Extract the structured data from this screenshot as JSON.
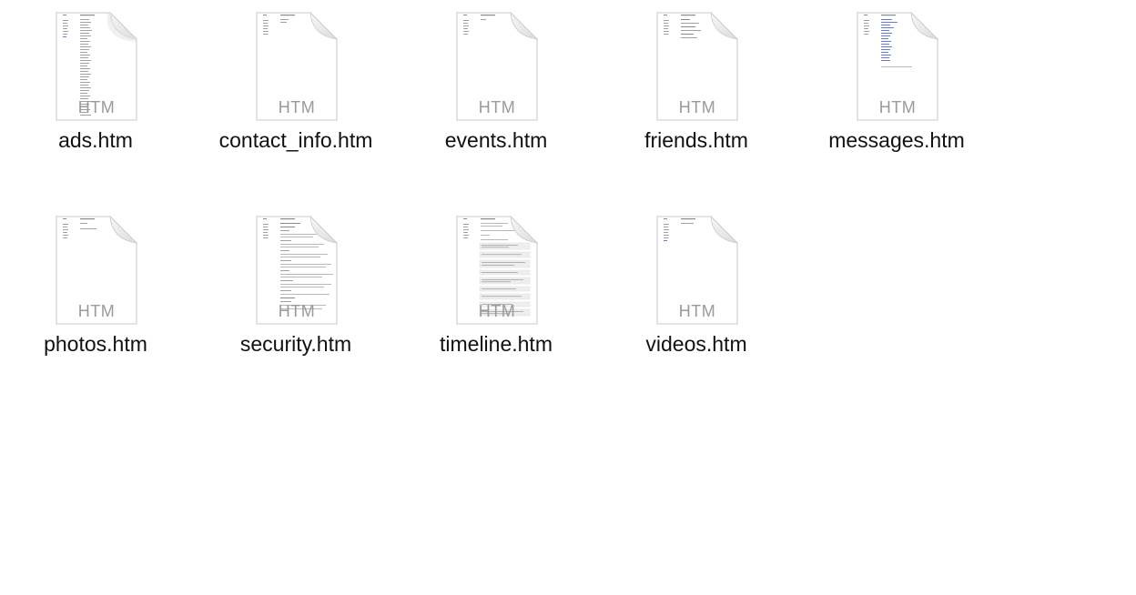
{
  "files": [
    {
      "name": "ads.htm",
      "ext": "HTM",
      "preview": "sidebar-list"
    },
    {
      "name": "contact_info.htm",
      "ext": "HTM",
      "preview": "short"
    },
    {
      "name": "events.htm",
      "ext": "HTM",
      "preview": "short"
    },
    {
      "name": "friends.htm",
      "ext": "HTM",
      "preview": "sections"
    },
    {
      "name": "messages.htm",
      "ext": "HTM",
      "preview": "list"
    },
    {
      "name": "photos.htm",
      "ext": "HTM",
      "preview": "short"
    },
    {
      "name": "security.htm",
      "ext": "HTM",
      "preview": "dense"
    },
    {
      "name": "timeline.htm",
      "ext": "HTM",
      "preview": "dense-boxes"
    },
    {
      "name": "videos.htm",
      "ext": "HTM",
      "preview": "short"
    }
  ],
  "colors": {
    "page_bg": "#ffffff",
    "doc_fill": "#ffffff",
    "doc_border": "#c9c9c9",
    "ext_text": "#9a9a9a",
    "name_text": "#111111",
    "preview_link": "#3b5bdb",
    "preview_text": "#7a7a7a"
  }
}
